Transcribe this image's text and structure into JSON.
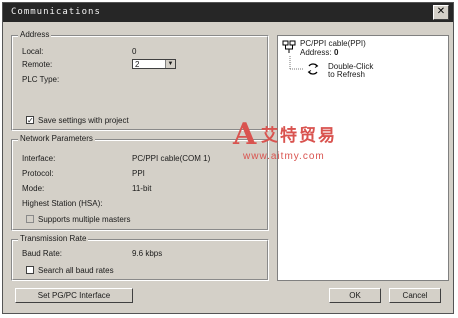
{
  "window": {
    "title": "Communications",
    "close_icon": "close-icon"
  },
  "address": {
    "title": "Address",
    "local_label": "Local:",
    "local_value": "0",
    "remote_label": "Remote:",
    "remote_value": "2",
    "plc_type_label": "PLC Type:",
    "save_settings_label": "Save settings with project",
    "save_settings_checked": true
  },
  "network": {
    "title": "Network Parameters",
    "interface_label": "Interface:",
    "interface_value": "PC/PPI cable(COM 1)",
    "protocol_label": "Protocol:",
    "protocol_value": "PPI",
    "mode_label": "Mode:",
    "mode_value": "11-bit",
    "hsa_label": "Highest Station (HSA):",
    "multi_masters_label": "Supports multiple masters"
  },
  "transmission": {
    "title": "Transmission Rate",
    "baud_label": "Baud Rate:",
    "baud_value": "9.6 kbps",
    "search_label": "Search all baud rates"
  },
  "buttons": {
    "set_pg_pc": "Set PG/PC Interface",
    "ok": "OK",
    "cancel": "Cancel"
  },
  "tree": {
    "cable_label": "PC/PPI cable(PPI)",
    "address_label": "Address:",
    "address_value": "0",
    "refresh_line1": "Double-Click",
    "refresh_line2": "to Refresh"
  },
  "watermark": {
    "brand": "艾特贸易",
    "url": "www.aitmy.com",
    "letter": "A",
    "color": "#d9534f"
  }
}
